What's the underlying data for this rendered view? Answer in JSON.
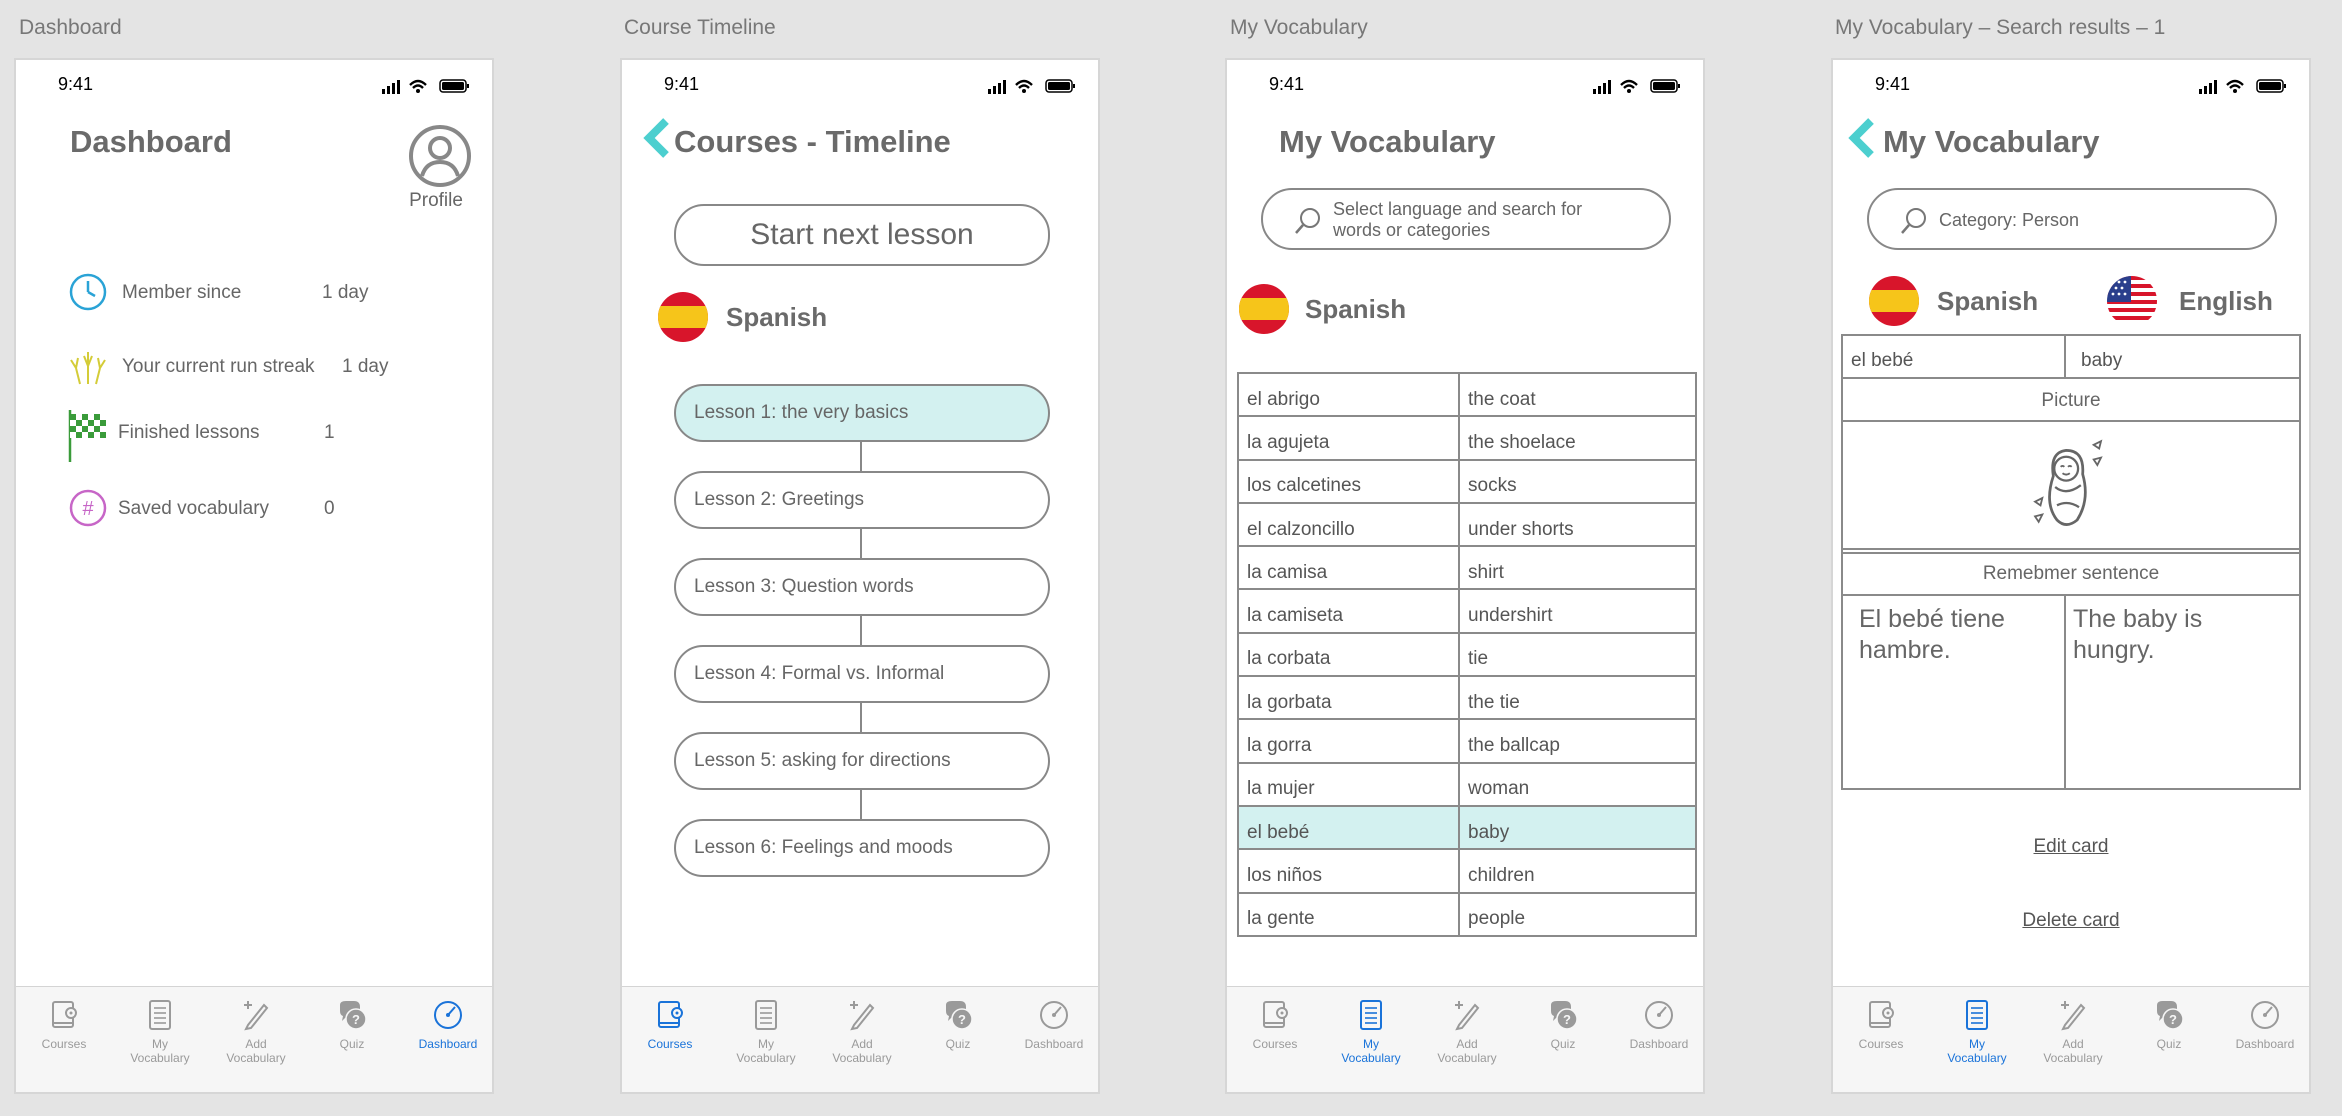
{
  "status_time": "9:41",
  "tabs": {
    "courses": "Courses",
    "vocab_l1": "My",
    "vocab_l2": "Vocabulary",
    "add_l1": "Add",
    "add_l2": "Vocabulary",
    "quiz": "Quiz",
    "dashboard": "Dashboard"
  },
  "colors": {
    "accent_blue": "#1a73d9",
    "teal_back": "#4ccfcf",
    "highlight": "#d3f1f0"
  },
  "screens": {
    "dashboard": {
      "artboard_label": "Dashboard",
      "title": "Dashboard",
      "profile_label": "Profile",
      "stats": [
        {
          "label": "Member since",
          "value": "1 day",
          "icon": "clock-icon"
        },
        {
          "label": "Your current run streak",
          "value": "1 day",
          "icon": "fireworks-icon"
        },
        {
          "label": "Finished lessons",
          "value": "1",
          "icon": "checkered-flag-icon"
        },
        {
          "label": "Saved vocabulary",
          "value": "0",
          "icon": "hashtag-icon"
        }
      ]
    },
    "timeline": {
      "artboard_label": "Course Timeline",
      "title": "Courses - Timeline",
      "start_button": "Start next lesson",
      "language": "Spanish",
      "lessons": [
        "Lesson 1: the very basics",
        "Lesson 2: Greetings",
        "Lesson 3: Question words",
        "Lesson 4: Formal vs. Informal",
        "Lesson 5: asking for directions",
        "Lesson 6: Feelings and moods"
      ]
    },
    "vocabulary": {
      "artboard_label": "My Vocabulary",
      "title": "My Vocabulary",
      "search_placeholder_l1": "Select language and search for",
      "search_placeholder_l2": "words or categories",
      "language": "Spanish",
      "rows": [
        [
          "el abrigo",
          "the coat"
        ],
        [
          "la agujeta",
          "the shoelace"
        ],
        [
          "los calcetines",
          "socks"
        ],
        [
          "el calzoncillo",
          "under shorts"
        ],
        [
          "la camisa",
          "shirt"
        ],
        [
          "la camiseta",
          "undershirt"
        ],
        [
          "la corbata",
          "tie"
        ],
        [
          "la gorbata",
          "the tie"
        ],
        [
          "la gorra",
          "the ballcap"
        ],
        [
          "la mujer",
          "woman"
        ],
        [
          "el bebé",
          "baby"
        ],
        [
          "los niños",
          "children"
        ],
        [
          "la gente",
          "people"
        ]
      ],
      "highlight_row": 10
    },
    "search_results": {
      "artboard_label": "My Vocabulary – Search results – 1",
      "title": "My Vocabulary",
      "search_value": "Category: Person",
      "language_from": "Spanish",
      "language_to": "English",
      "word_es": "el bebé",
      "word_en": "baby",
      "picture_label": "Picture",
      "sentence_label": "Remebmer sentence",
      "sentence_es": "El bebé tiene hambre.",
      "sentence_en": "The baby is hungry.",
      "edit_link": "Edit card",
      "delete_link": "Delete card"
    }
  }
}
